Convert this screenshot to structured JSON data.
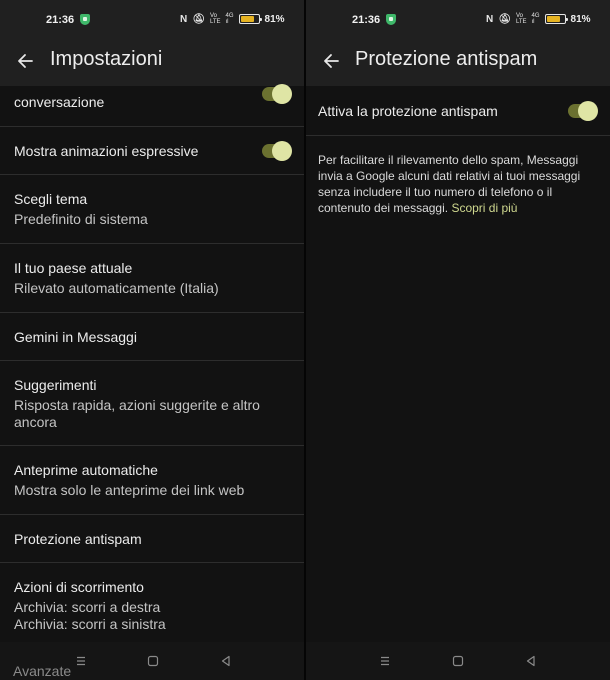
{
  "status_bar": {
    "time": "21:36",
    "battery_pct": "81%",
    "battery_level": 0.81,
    "net_top": "4G",
    "net_bottom": "ıl",
    "signal_top": "Vo",
    "signal_bottom": "LTE"
  },
  "left": {
    "title": "Impostazioni",
    "items": [
      {
        "title": "conversazione",
        "toggle": true
      },
      {
        "title": "Mostra animazioni espressive",
        "toggle": true
      },
      {
        "title": "Scegli tema",
        "subtitle": "Predefinito di sistema"
      },
      {
        "title": "Il tuo paese attuale",
        "subtitle": "Rilevato automaticamente (Italia)"
      },
      {
        "title": "Gemini in Messaggi"
      },
      {
        "title": "Suggerimenti",
        "subtitle_1": "Risposta rapida, azioni suggerite e altro",
        "subtitle_2": "ancora"
      },
      {
        "title": "Anteprime automatiche",
        "subtitle": "Mostra solo le anteprime dei link web"
      },
      {
        "title": "Protezione antispam"
      },
      {
        "title": "Azioni di scorrimento",
        "subtitle_1": "Archivia: scorri a destra",
        "subtitle_2": "Archivia: scorri a sinistra"
      }
    ],
    "peek_label": "Avanzate"
  },
  "right": {
    "title": "Protezione antispam",
    "toggle_label": "Attiva la protezione antispam",
    "toggle_on": true,
    "desc_1": "Per facilitare il rilevamento dello spam, Messaggi",
    "desc_2": "invia a Google alcuni dati relativi ai tuoi messaggi",
    "desc_3": "senza includere il tuo numero di telefono o il",
    "desc_4": "contenuto dei messaggi.",
    "learn_more": "Scopri di più"
  },
  "colors": {
    "toggle_track": "#6b7130",
    "toggle_knob": "#dfe5a5",
    "link": "#cfd88f",
    "battery": "#e6b322",
    "shield": "#3fb86a"
  },
  "icons": [
    "back-arrow-icon",
    "shield-icon",
    "nfc-icon",
    "mute-icon",
    "battery-icon",
    "recents-icon",
    "home-icon",
    "back-nav-icon"
  ]
}
